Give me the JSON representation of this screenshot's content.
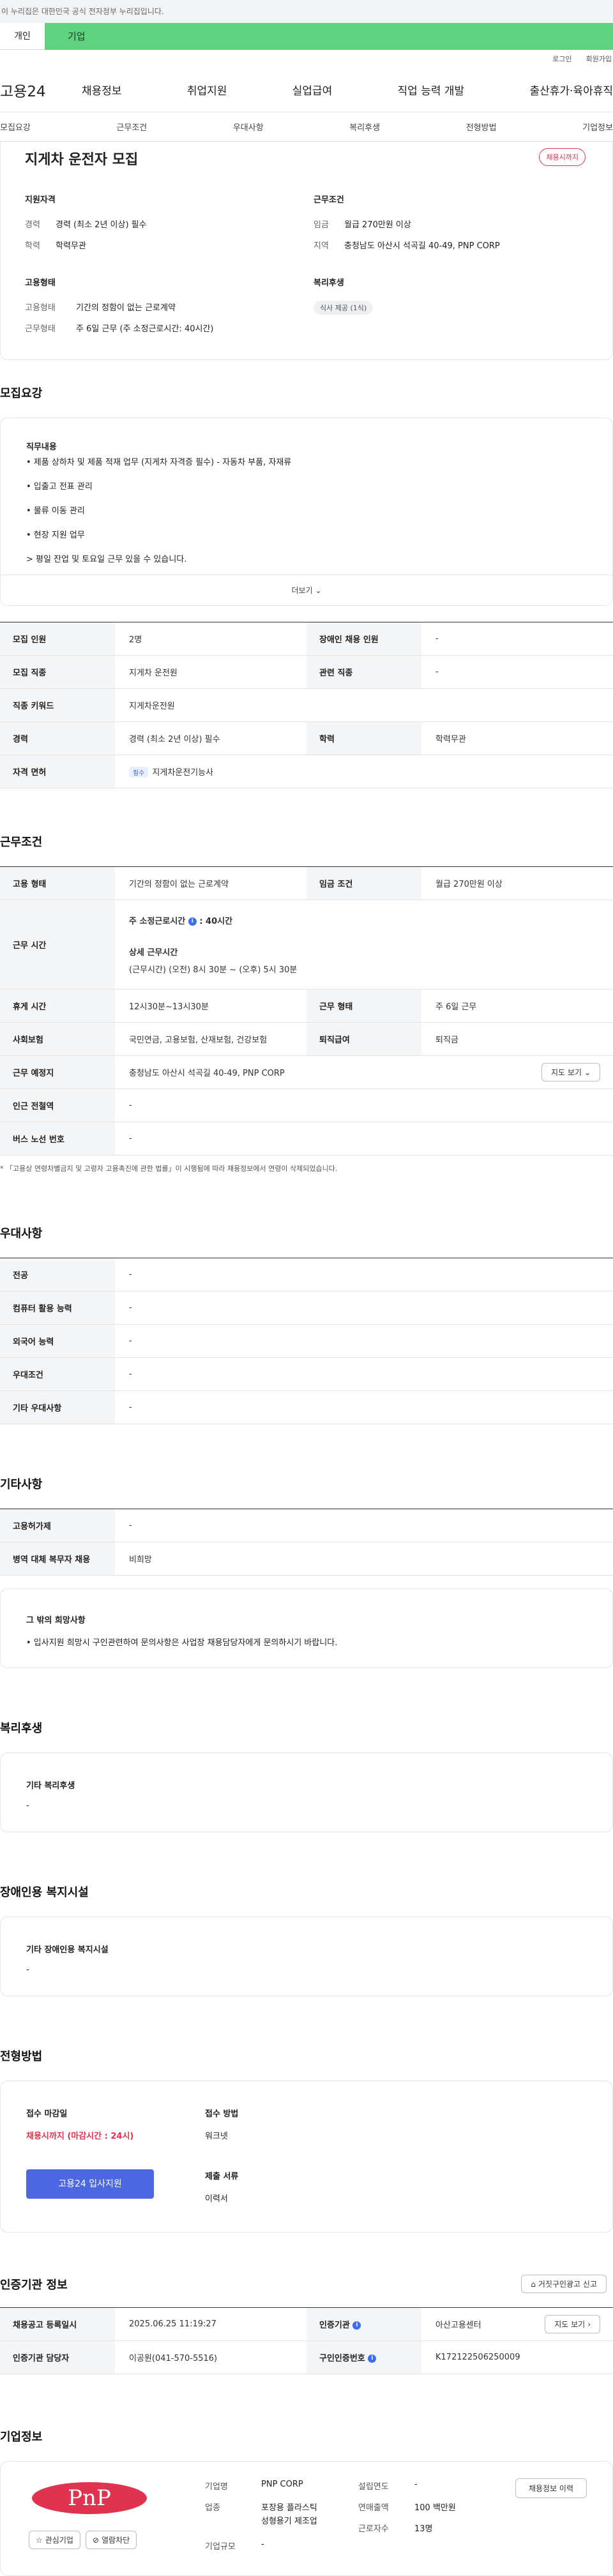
{
  "gov_banner": "이 누리집은 대한민국 공식 전자정부 누리집입니다.",
  "tabs": {
    "personal": "개인",
    "enterprise": "기업"
  },
  "util": {
    "login": "로그인",
    "join": "회원가입"
  },
  "gnb": {
    "logo": "고용24",
    "items": [
      "채용정보",
      "취업지원",
      "실업급여",
      "직업 능력 개발",
      "출산휴가·육아휴직"
    ]
  },
  "snb": [
    "모집요강",
    "근무조건",
    "우대사항",
    "복리후생",
    "전형방법",
    "기업정보"
  ],
  "summary": {
    "title": "지게차 운전자 모집",
    "badge": "채용시까지",
    "qual": {
      "heading": "지원자격",
      "career_k": "경력",
      "career_v": "경력 (최소 2년 이상) 필수",
      "edu_k": "학력",
      "edu_v": "학력무관"
    },
    "cond": {
      "heading": "근무조건",
      "wage_k": "임금",
      "wage_v": "월급 270만원 이상",
      "area_k": "지역",
      "area_v": "충청남도 아산시 석곡길 40-49, PNP CORP"
    },
    "emp": {
      "heading": "고용형태",
      "type_k": "고용형태",
      "type_v": "기간의 정함이 없는 근로계약",
      "work_k": "근무형태",
      "work_v": "주 6일 근무 (주 소정근로시간: 40시간)"
    },
    "welfare": {
      "heading": "복리후생",
      "chip": "식사 제공 (1식)"
    }
  },
  "recruit": {
    "title": "모집요강",
    "duty_heading": "직무내용",
    "duties": [
      "• 제품 상하차 및 제품 적재 업무 (지게차 자격증 필수) - 자동차 부품, 자재류",
      "• 입출고 전표 관리",
      "• 물류 이동 관리",
      "• 현장 지원 업무",
      "> 평일 잔업 및 토요일 근무 있을 수 있습니다."
    ],
    "more": "더보기",
    "rows": [
      {
        "k1": "모집 인원",
        "v1": "2명",
        "k2": "장애인 채용 인원",
        "v2": "-"
      },
      {
        "k1": "모집 직종",
        "v1": "지게차 운전원",
        "k2": "관련 직종",
        "v2": "-"
      },
      {
        "k1": "직종 키워드",
        "v1": "지게차운전원"
      },
      {
        "k1": "경력",
        "v1": "경력 (최소 2년 이상) 필수",
        "k2": "학력",
        "v2": "학력무관"
      },
      {
        "k1": "자격 면허",
        "chip": "필수",
        "v1": "지게차운전기능사"
      }
    ]
  },
  "work": {
    "title": "근무조건",
    "emp_type_k": "고용 형태",
    "emp_type_v": "기간의 정함이 없는 근로계약",
    "wage_k": "임금 조건",
    "wage_v": "월급 270만원 이상",
    "hours_k": "근무 시간",
    "hours_label": "주 소정근로시간",
    "hours_value": ": 40시간",
    "detail_label": "상세 근무시간",
    "detail_value": "(근무시간) (오전) 8시 30분 ~ (오후) 5시 30분",
    "rest_k": "휴게 시간",
    "rest_v": "12시30분~13시30분",
    "form_k": "근무 형태",
    "form_v": "주 6일 근무",
    "ins_k": "사회보험",
    "ins_v": "국민연금, 고용보험, 산재보험, 건강보험",
    "sev_k": "퇴직급여",
    "sev_v": "퇴직금",
    "place_k": "근무 예정지",
    "place_v": "충청남도 아산시 석곡길 40-49, PNP CORP",
    "map_btn": "지도 보기",
    "subway_k": "인근 전철역",
    "subway_v": "-",
    "bus_k": "버스 노선 번호",
    "bus_v": "-",
    "note": "* 「고용상 연령차별금지 및 고령자 고용촉진에 관한 법률」이 시행됨에 따라 채용정보에서 연령이 삭제되었습니다."
  },
  "pref": {
    "title": "우대사항",
    "rows": [
      {
        "k": "전공",
        "v": "-"
      },
      {
        "k": "컴퓨터 활용 능력",
        "v": "-"
      },
      {
        "k": "외국어 능력",
        "v": "-"
      },
      {
        "k": "우대조건",
        "v": "-"
      },
      {
        "k": "기타 우대사항",
        "v": "-"
      }
    ]
  },
  "etc": {
    "title": "기타사항",
    "rows": [
      {
        "k": "고용허가제",
        "v": "-"
      },
      {
        "k": "병역 대체 복무자 채용",
        "v": "비희망"
      }
    ],
    "other_heading": "그 밖의 희망사항",
    "other_text": "• 입사지원 희망시 구인관련하여 문의사항은 사업장 채용담당자에게 문의하시기 바랍니다."
  },
  "welfare": {
    "title": "복리후생",
    "heading": "기타 복리후생",
    "value": "-"
  },
  "disability": {
    "title": "장애인용 복지시설",
    "heading": "기타 장애인용 복지시설",
    "value": "-"
  },
  "process": {
    "title": "전형방법",
    "deadline_k": "접수 마감일",
    "deadline_v": "채용시까지 (마감시간 : 24시)",
    "apply_btn": "고용24 입사지원",
    "method_k": "접수 방법",
    "method_v": "워크넷",
    "docs_k": "제출 서류",
    "docs_v": "이력서"
  },
  "agency": {
    "title": "인증기관 정보",
    "report_btn": "거짓구인광고 신고",
    "reg_k": "채용공고 등록일시",
    "reg_v": "2025.06.25 11:19:27",
    "org_k": "인증기관",
    "org_v": "아산고용센터",
    "map_btn": "지도 보기",
    "mgr_k": "인증기관 담당자",
    "mgr_v": "이공원(041-570-5516)",
    "num_k": "구인인증번호",
    "num_v": "K172122506250009"
  },
  "company": {
    "title": "기업정보",
    "logo_text": "PnP",
    "interest_btn": "관심기업",
    "block_btn": "열람차단",
    "name_k": "기업명",
    "name_v": "PNP CORP",
    "industry_k": "업종",
    "industry_v1": "포장용 플라스틱",
    "industry_v2": "성형용기 제조업",
    "size_k": "기업규모",
    "size_v": "-",
    "year_k": "설립연도",
    "year_v": "-",
    "sales_k": "연매출액",
    "sales_v": "100 백만원",
    "staff_k": "근로자수",
    "staff_v": "13명",
    "history_btn": "채용정보 이력"
  },
  "colors": {
    "enterprise_tab": "#5fd17f",
    "primary_btn": "#4b68e0",
    "accent_red": "#e0334f"
  }
}
